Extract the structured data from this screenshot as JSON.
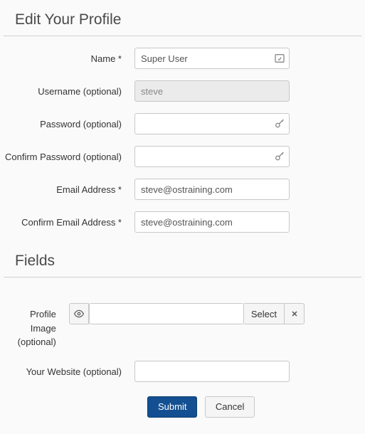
{
  "sections": {
    "profile": {
      "title": "Edit Your Profile"
    },
    "fields": {
      "title": "Fields"
    }
  },
  "form": {
    "name": {
      "label": "Name *",
      "value": "Super User"
    },
    "username": {
      "label": "Username (optional)",
      "value": "steve"
    },
    "password": {
      "label": "Password (optional)",
      "value": ""
    },
    "confirm_password": {
      "label": "Confirm Password (optional)",
      "value": ""
    },
    "email": {
      "label": "Email Address *",
      "value": "steve@ostraining.com"
    },
    "confirm_email": {
      "label": "Confirm Email Address *",
      "value": "steve@ostraining.com"
    },
    "profile_image": {
      "label": "Profile Image (optional)",
      "value": "",
      "select_label": "Select"
    },
    "website": {
      "label": "Your Website (optional)",
      "value": ""
    }
  },
  "actions": {
    "submit": "Submit",
    "cancel": "Cancel"
  }
}
